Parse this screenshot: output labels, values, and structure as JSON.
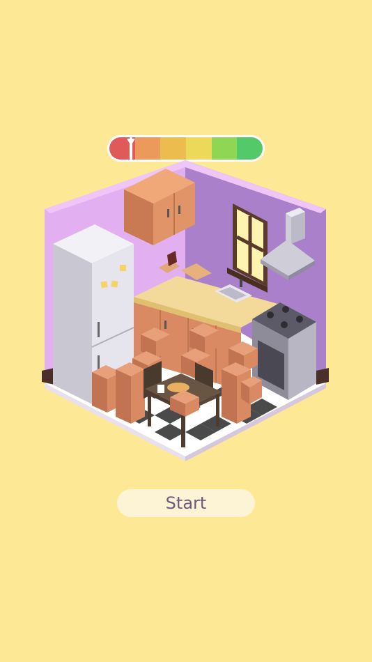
{
  "colors": {
    "background": "#fde895",
    "button_bg": "#fdf4d6",
    "button_text": "#6b5a7d",
    "meter_segments": [
      "#e05a5a",
      "#ec9a5c",
      "#ecbc4e",
      "#ecd95a",
      "#90d655",
      "#54c96a"
    ],
    "wall_left": "#e2b0f0",
    "wall_right": "#a980c9",
    "floor_dark": "#4a4a4a",
    "box": "#d98a62"
  },
  "meter": {
    "segment_count": 6,
    "value": 0.07
  },
  "scene": {
    "name": "kitchen-room",
    "boxes": 14
  },
  "start_button": {
    "label": "Start"
  }
}
